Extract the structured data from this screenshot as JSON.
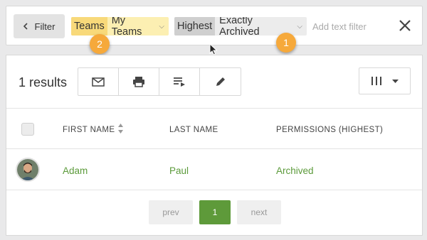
{
  "filter_bar": {
    "filter_button_label": "Filter",
    "teams_chip": {
      "key": "Teams",
      "value": "My Teams"
    },
    "permissions_chip": {
      "key": "Highest",
      "value": "Exactly Archived"
    },
    "text_filter_placeholder": "Add text filter",
    "clear_icon": "close-icon"
  },
  "callouts": {
    "badge_1": "1",
    "badge_2": "2"
  },
  "results": {
    "count_label": "1 results",
    "toolbar_icons": [
      "mail-icon",
      "print-icon",
      "playlist-icon",
      "pencil-icon"
    ],
    "columns_icon": "columns-icon"
  },
  "table": {
    "headers": [
      "FIRST NAME",
      "LAST NAME",
      "PERMISSIONS (HIGHEST)"
    ],
    "rows": [
      {
        "first_name": "Adam",
        "last_name": "Paul",
        "permissions": "Archived"
      }
    ]
  },
  "pagination": {
    "prev": "prev",
    "current": "1",
    "next": "next"
  },
  "colors": {
    "accent_green": "#5e9a3a",
    "teams_chip": "#fcefb2",
    "badge_orange": "#f6a93b"
  }
}
